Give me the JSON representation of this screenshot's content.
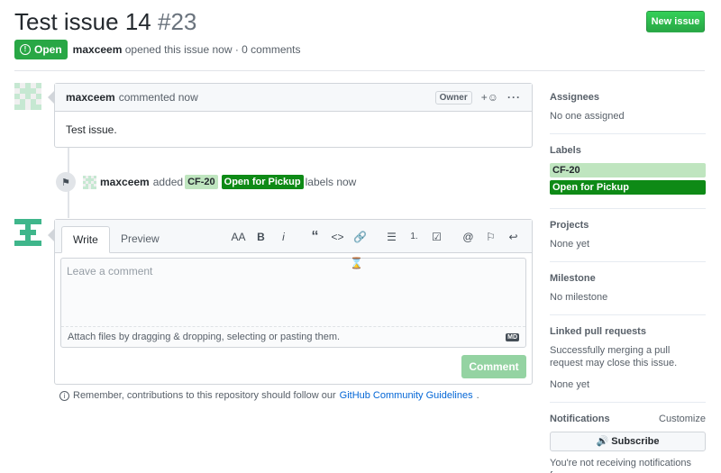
{
  "header": {
    "title": "Test issue 14",
    "number": "#23",
    "new_issue_label": "New issue"
  },
  "meta": {
    "state": "Open",
    "author": "maxceem",
    "opened_text": "opened this issue now · 0 comments"
  },
  "comment": {
    "author": "maxceem",
    "time_text": "commented now",
    "role_badge": "Owner",
    "body": "Test issue."
  },
  "event": {
    "actor": "maxceem",
    "action": "added",
    "labels": [
      "CF-20",
      "Open for Pickup"
    ],
    "suffix": "labels now"
  },
  "editor": {
    "tabs": [
      "Write",
      "Preview"
    ],
    "placeholder": "Leave a comment",
    "attach_text": "Attach files by dragging & dropping, selecting or pasting them.",
    "submit_label": "Comment",
    "toolbar": [
      "AA",
      "B",
      "i",
      "“",
      "<>",
      "🔗",
      "☰",
      "1.",
      "☑",
      "@",
      "⚐",
      "↩"
    ]
  },
  "guidelines": {
    "text": "Remember, contributions to this repository should follow our",
    "link": "GitHub Community Guidelines",
    "end": "."
  },
  "sidebar": {
    "assignees": {
      "title": "Assignees",
      "value": "No one assigned"
    },
    "labels": {
      "title": "Labels",
      "items": [
        "CF-20",
        "Open for Pickup"
      ]
    },
    "projects": {
      "title": "Projects",
      "value": "None yet"
    },
    "milestone": {
      "title": "Milestone",
      "value": "No milestone"
    },
    "linked": {
      "title": "Linked pull requests",
      "desc": "Successfully merging a pull request may close this issue.",
      "value": "None yet"
    },
    "notifications": {
      "title": "Notifications",
      "customize": "Customize",
      "subscribe": "Subscribe",
      "note": "You're not receiving notifications from"
    }
  },
  "colors": {
    "open_green": "#28a745",
    "label_cf20": "#bfe5bf",
    "label_pickup": "#0e8a16",
    "comment_btn_disabled": "#94d3a2",
    "link_blue": "#0366d6"
  }
}
